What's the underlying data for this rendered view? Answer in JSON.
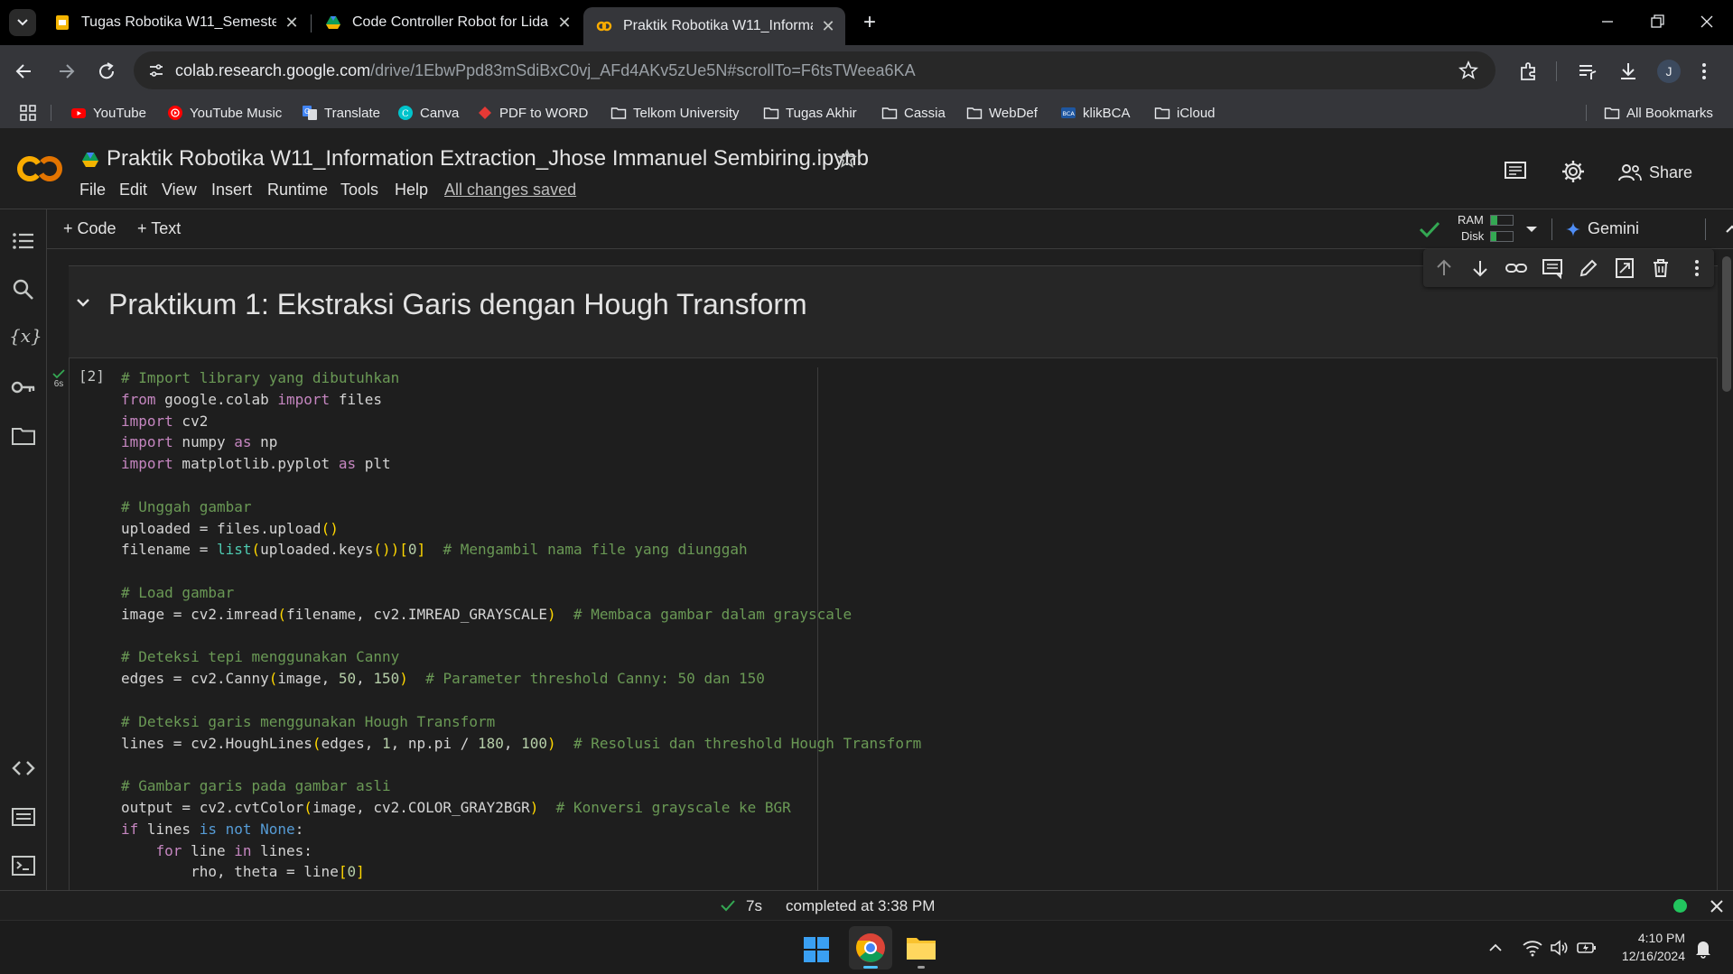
{
  "browser": {
    "tabs": [
      {
        "title": "Tugas Robotika W11_Semester",
        "active": false
      },
      {
        "title": "Code Controller Robot for Lidar",
        "active": false
      },
      {
        "title": "Praktik Robotika W11_Informati",
        "active": true
      }
    ],
    "url_host": "colab.research.google.com",
    "url_path": "/drive/1EbwPpd83mSdiBxC0vj_AFd4AKv5zUe5N#scrollTo=F6tsTWeea6KA",
    "profile_initial": "J",
    "bookmarks": [
      {
        "label": "YouTube",
        "icon": "youtube-icon"
      },
      {
        "label": "YouTube Music",
        "icon": "youtube-music-icon"
      },
      {
        "label": "Translate",
        "icon": "translate-icon"
      },
      {
        "label": "Canva",
        "icon": "canva-icon"
      },
      {
        "label": "PDF to WORD",
        "icon": "pdf-icon"
      },
      {
        "label": "Telkom University",
        "icon": "folder-icon"
      },
      {
        "label": "Tugas Akhir",
        "icon": "folder-icon"
      },
      {
        "label": "Cassia",
        "icon": "folder-icon"
      },
      {
        "label": "WebDef",
        "icon": "folder-icon"
      },
      {
        "label": "klikBCA",
        "icon": "bca-icon"
      },
      {
        "label": "iCloud",
        "icon": "folder-icon"
      }
    ],
    "all_bookmarks": "All Bookmarks"
  },
  "colab": {
    "logo": "CO",
    "notebook_title": "Praktik Robotika W11_Information Extraction_Jhose Immanuel Sembiring.ipynb",
    "menu": [
      "File",
      "Edit",
      "View",
      "Insert",
      "Runtime",
      "Tools",
      "Help"
    ],
    "saved_status": "All changes saved",
    "share_label": "Share",
    "add_code": "+ Code",
    "add_text": "+ Text",
    "ram_label": "RAM",
    "disk_label": "Disk",
    "gemini_label": "Gemini",
    "heading": "Praktikum 1: Ekstraksi Garis dengan Hough Transform",
    "exec_count": "[2]",
    "exec_time": "6s",
    "status_time": "7s",
    "status_text": "completed at 3:38 PM"
  },
  "taskbar": {
    "time": "4:10 PM",
    "date": "12/16/2024"
  },
  "colors": {
    "colab_orange": "#f9ab00",
    "check_green": "#34a853",
    "comment": "#6a9955",
    "keyword": "#c586c0"
  }
}
